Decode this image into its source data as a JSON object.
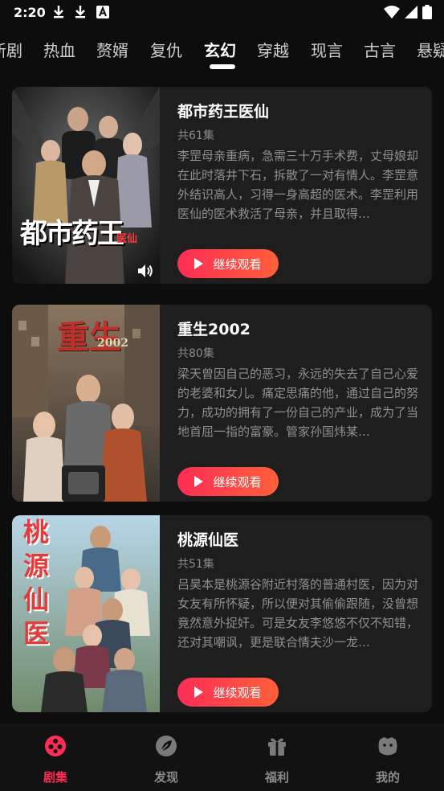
{
  "status_bar": {
    "time": "2:20",
    "icons": [
      "download-icon",
      "download-icon",
      "a-icon",
      "wifi-icon",
      "signal-icon",
      "battery-icon"
    ]
  },
  "tabs": [
    {
      "label": "新剧",
      "active": false
    },
    {
      "label": "热血",
      "active": false
    },
    {
      "label": "赘婿",
      "active": false
    },
    {
      "label": "复仇",
      "active": false
    },
    {
      "label": "玄幻",
      "active": true
    },
    {
      "label": "穿越",
      "active": false
    },
    {
      "label": "现言",
      "active": false
    },
    {
      "label": "古言",
      "active": false
    },
    {
      "label": "悬疑",
      "active": false
    }
  ],
  "dramas": [
    {
      "title": "都市药王医仙",
      "episodes": "共61集",
      "description": "李罡母亲重病，急需三十万手术费，丈母娘却在此时落井下石，拆散了一对有情人。李罡意外结识高人，习得一身高超的医术。李罡利用医仙的医术救活了母亲，并且取得…",
      "button": "继续观看",
      "poster_text": "都市药王",
      "poster_subtext": "医仙"
    },
    {
      "title": "重生2002",
      "episodes": "共80集",
      "description": "梁天曾因自己的恶习，永远的失去了自己心爱的老婆和女儿。痛定思痛的他，通过自己的努力，成功的拥有了一份自己的产业，成为了当地首屈一指的富豪。管家孙国炜某…",
      "button": "继续观看",
      "poster_text": "重生",
      "poster_subtext": "2002"
    },
    {
      "title": "桃源仙医",
      "episodes": "共51集",
      "description": "吕昊本是桃源谷附近村落的普通村医，因为对女友有所怀疑，所以便对其偷偷跟随，没曾想竟然意外捉奸。可是女友李悠悠不仅不知错，还对其嘲讽，更是联合情夫沙一龙…",
      "button": "继续观看",
      "poster_text": "桃源仙医",
      "poster_subtext": ""
    }
  ],
  "bottom_nav": [
    {
      "label": "剧集",
      "icon": "film-reel-icon",
      "active": true
    },
    {
      "label": "发现",
      "icon": "compass-leaf-icon",
      "active": false
    },
    {
      "label": "福利",
      "icon": "gift-icon",
      "active": false
    },
    {
      "label": "我的",
      "icon": "profile-face-icon",
      "active": false
    }
  ],
  "colors": {
    "accent": "#ff2d55",
    "accent_end": "#ff5f3a",
    "background": "#0d0d0d",
    "card": "#1e1e1e"
  }
}
